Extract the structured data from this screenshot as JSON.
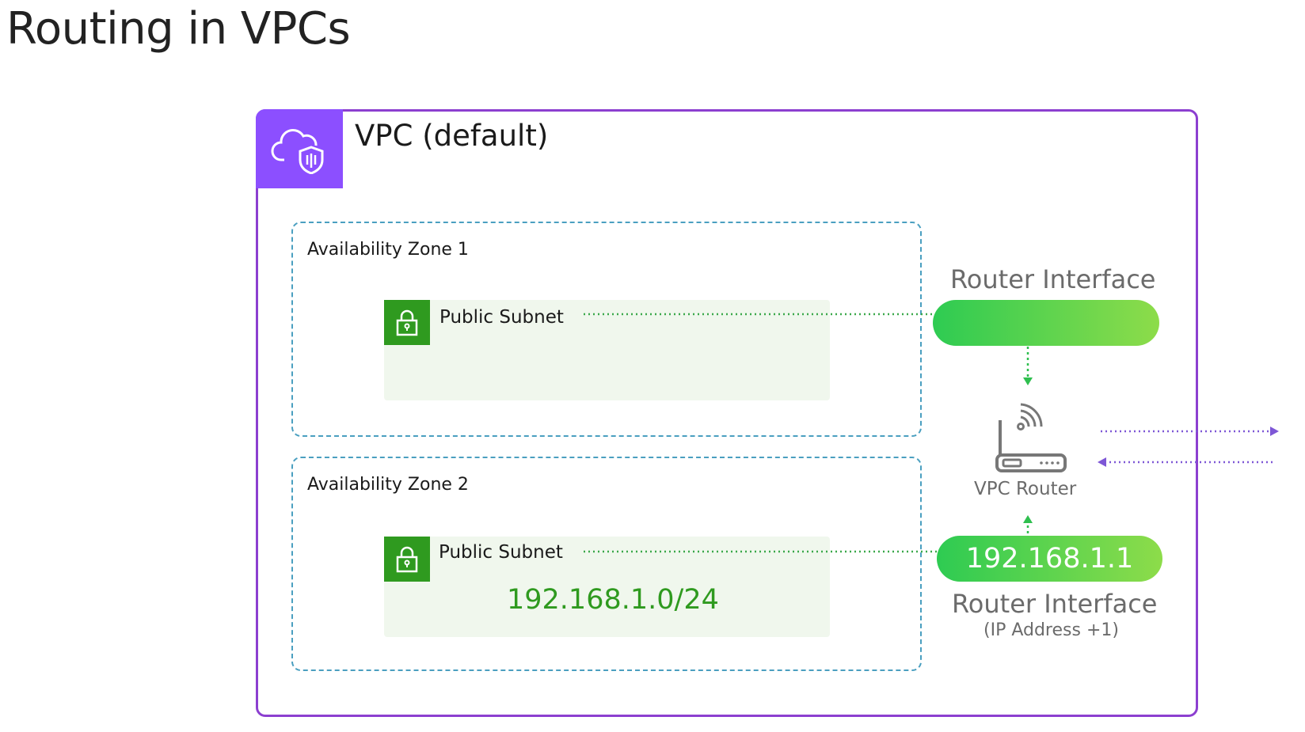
{
  "page": {
    "title": "Routing in VPCs"
  },
  "vpc": {
    "title": "VPC (default)",
    "icon": "cloud-shield-icon",
    "border_color": "#8c3fd0",
    "badge_color": "#8c4fff"
  },
  "zones": [
    {
      "label": "Availability Zone 1",
      "subnet": {
        "label": "Public Subnet",
        "cidr": "",
        "icon": "lock-icon"
      }
    },
    {
      "label": "Availability Zone 2",
      "subnet": {
        "label": "Public Subnet",
        "cidr": "192.168.1.0/24",
        "icon": "lock-icon"
      }
    }
  ],
  "router_interface_top": {
    "label": "Router Interface",
    "value": ""
  },
  "router_interface_bottom": {
    "label": "Router Interface",
    "sublabel": "(IP Address +1)",
    "value": "192.168.1.1"
  },
  "router": {
    "label": "VPC Router",
    "icon": "router-icon"
  },
  "colors": {
    "subnet_green": "#2f9a1f",
    "pill_start": "#2ecb52",
    "pill_end": "#8ddc4a",
    "az_dash": "#4a9fc0",
    "external_arrow": "#7e57d6"
  }
}
